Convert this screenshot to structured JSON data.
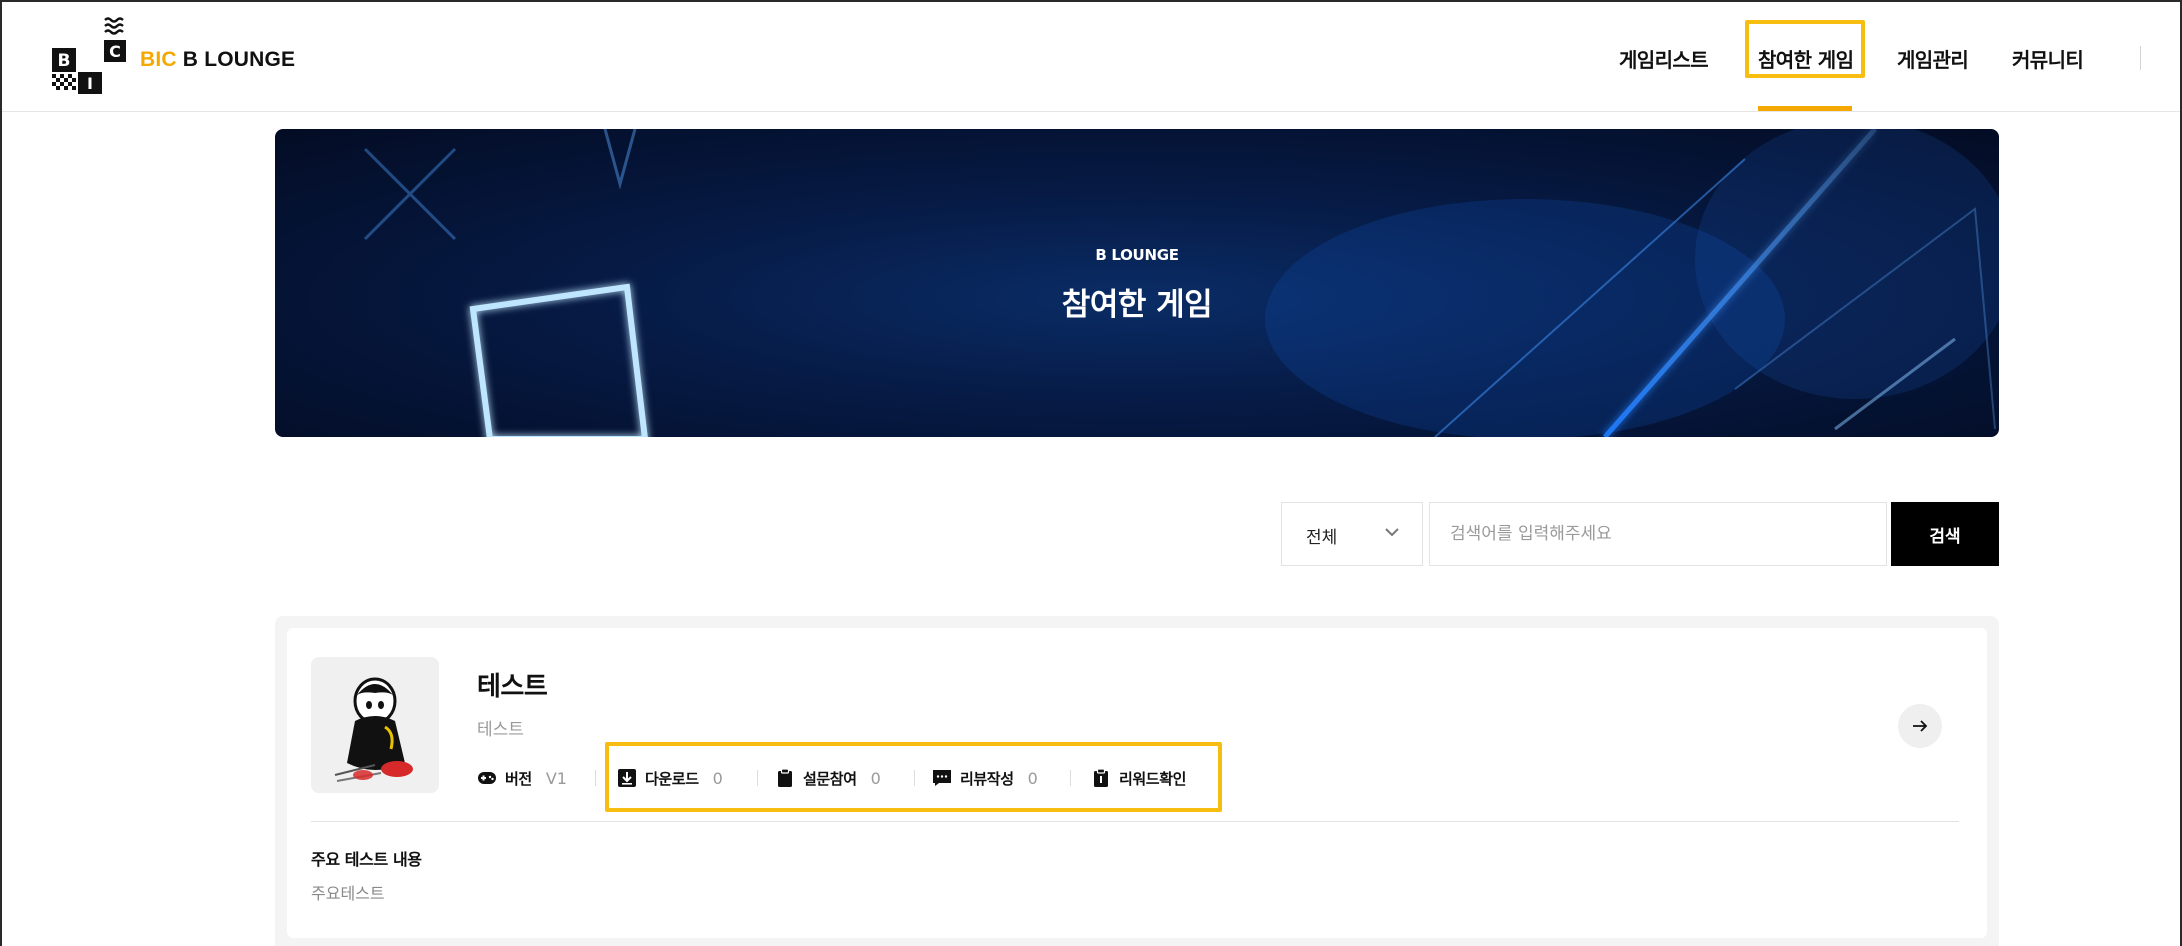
{
  "header": {
    "brand_accent": "BIC",
    "brand_rest": " B LOUNGE",
    "logo_letters": [
      "B",
      "C",
      "I"
    ],
    "nav": [
      {
        "label": "게임리스트",
        "active": false
      },
      {
        "label": "참여한 게임",
        "active": true
      },
      {
        "label": "게임관리",
        "active": false
      },
      {
        "label": "커뮤니티",
        "active": false
      }
    ]
  },
  "banner": {
    "subtitle": "B LOUNGE",
    "title": "참여한 게임"
  },
  "search": {
    "filter_value": "전체",
    "placeholder": "검색어를 입력해주세요",
    "button_label": "검색"
  },
  "game": {
    "title": "테스트",
    "subtitle": "테스트",
    "version_label": "버전",
    "version_value": "V1",
    "download_label": "다운로드",
    "download_count": "0",
    "survey_label": "설문참여",
    "survey_count": "0",
    "review_label": "리뷰작성",
    "review_count": "0",
    "review_check_label": "리워드확인",
    "test_content_label": "주요 테스트 내용",
    "test_content_value": "주요테스트"
  },
  "colors": {
    "accent": "#f5a800",
    "highlight": "#f7bd10",
    "banner_dark": "#030c24",
    "button_black": "#000000"
  },
  "icons": {
    "version": "gamepad-icon",
    "download": "download-icon",
    "survey": "clipboard-icon",
    "review": "chat-icon",
    "review_check": "clipboard-check-icon",
    "arrow": "arrow-right-icon",
    "filter": "chevron-down-icon"
  }
}
